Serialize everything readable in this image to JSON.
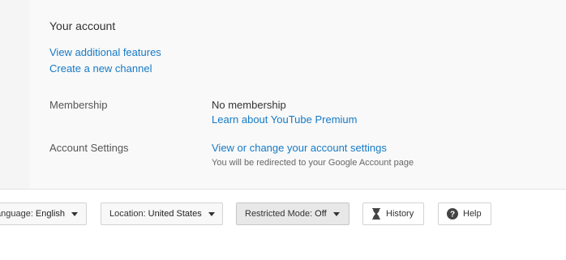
{
  "account": {
    "title": "Your account",
    "links": {
      "view_features": "View additional features",
      "create_channel": "Create a new channel"
    },
    "membership": {
      "label": "Membership",
      "value": "No membership",
      "link": "Learn about YouTube Premium"
    },
    "settings": {
      "label": "Account Settings",
      "link": "View or change your account settings",
      "note": "You will be redirected to your Google Account page"
    }
  },
  "footer": {
    "language": {
      "prefix": "anguage:",
      "value": "English"
    },
    "location": {
      "prefix": "Location:",
      "value": "United States"
    },
    "restricted": {
      "prefix": "Restricted Mode:",
      "value": "Off"
    },
    "history": {
      "label": "History",
      "icon": "hourglass-icon"
    },
    "help": {
      "label": "Help",
      "icon": "help-icon"
    }
  },
  "colors": {
    "link": "#167ac6",
    "panel_bg": "#f9f9f9",
    "gutter_bg": "#f5f5f5",
    "restricted_bg": "#e8e8e8"
  }
}
